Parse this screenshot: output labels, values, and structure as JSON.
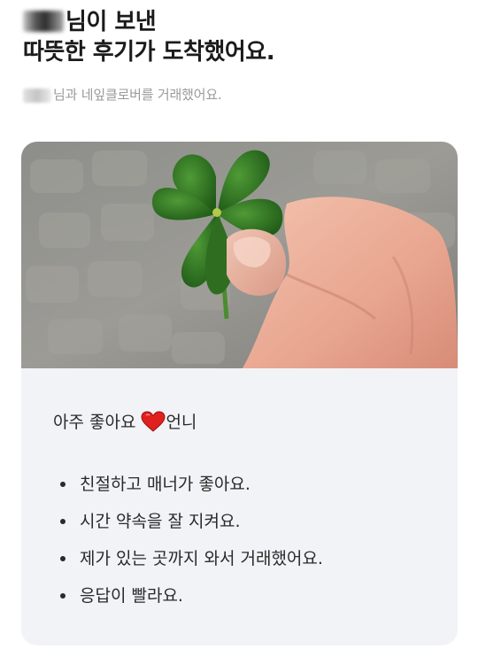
{
  "header": {
    "title_line1_suffix": "님이 보낸",
    "title_line2": "따뜻한 후기가 도착했어요.",
    "subtitle_suffix": "님과 네잎클로버를 거래했어요."
  },
  "review": {
    "photo_description_icon": "four-leaf-clover-photo",
    "headline_before_heart": "아주 좋아요",
    "headline_after_heart": "언니",
    "heart_color": "#e0201f",
    "tags": [
      "친절하고 매너가 좋아요.",
      "시간 약속을 잘 지켜요.",
      "제가 있는 곳까지 와서 거래했어요.",
      "응답이 빨라요."
    ]
  },
  "colors": {
    "card_background": "#f2f3f6",
    "title_text": "#1b1b1b",
    "subtitle_text": "#9a9a9a"
  }
}
